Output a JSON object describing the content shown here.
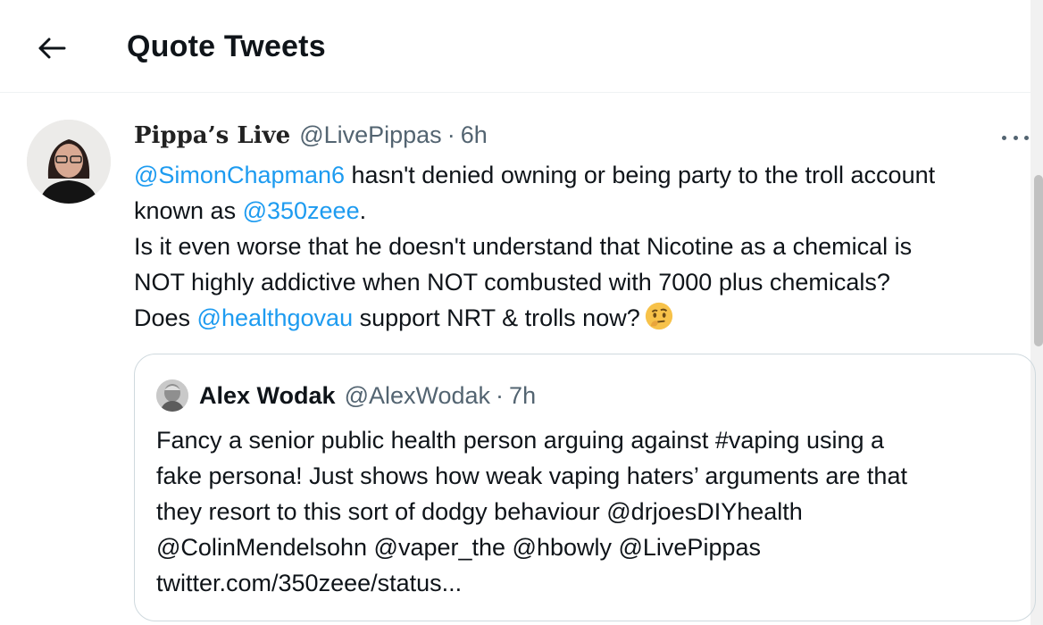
{
  "header": {
    "back_icon": "arrow-left-icon",
    "title": "Quote Tweets"
  },
  "tweet": {
    "display_name": "Pippa’s Live",
    "handle": "@LivePippas",
    "separator": "·",
    "time": "6h",
    "more_icon": "more-horizontal-icon",
    "lines": {
      "l1_mention": "@SimonChapman6",
      "l1_text": " hasn't denied owning or being party to the troll account",
      "l2_text": "known as ",
      "l2_mention": "@350zeee",
      "l2_tail": ".",
      "l3_text": "Is it even worse that he doesn't understand that Nicotine as a chemical is",
      "l4_text": "NOT highly addictive when NOT combusted with 7000 plus chemicals?",
      "l5_text": "Does ",
      "l5_mention": "@healthgovau",
      "l5_tail": " support NRT & trolls now?",
      "emoji": "thinking-face-emoji"
    }
  },
  "quote": {
    "display_name": "Alex Wodak",
    "handle": "@AlexWodak",
    "separator": "·",
    "time": "7h",
    "lines": [
      "Fancy a senior public health person arguing against #vaping using a",
      "fake persona! Just shows how weak vaping haters’ arguments are that",
      "they resort to this sort of dodgy behaviour @drjoesDIYhealth",
      "@ColinMendelsohn @vaper_the @hbowly @LivePippas",
      "twitter.com/350zeee/status..."
    ]
  },
  "colors": {
    "link": "#1d9bf0",
    "text": "#0f1419",
    "secondary": "#536471",
    "border": "#cfd9de"
  }
}
